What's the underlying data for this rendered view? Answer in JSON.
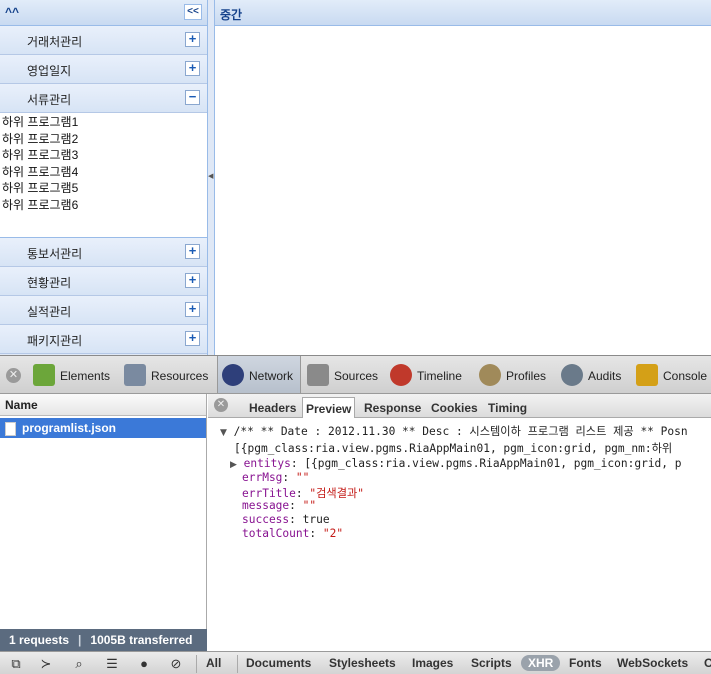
{
  "nav": {
    "header": "^^",
    "collapse_label": "<<",
    "items": [
      {
        "label": "거래처관리",
        "tool": "+"
      },
      {
        "label": "영업일지",
        "tool": "+"
      },
      {
        "label": "서류관리",
        "tool": "−"
      },
      {
        "label": "통보서관리",
        "tool": "+"
      },
      {
        "label": "현황관리",
        "tool": "+"
      },
      {
        "label": "실적관리",
        "tool": "+"
      },
      {
        "label": "패키지관리",
        "tool": "+"
      }
    ],
    "sub_items": [
      "하위 프로그램1",
      "하위 프로그램2",
      "하위 프로그램3",
      "하위 프로그램4",
      "하위 프로그램5",
      "하위 프로그램6"
    ]
  },
  "center": {
    "title": "중간"
  },
  "devtools": {
    "tabs": [
      {
        "label": "Elements",
        "icon": "elements-icon",
        "color": "#6ca63a"
      },
      {
        "label": "Resources",
        "icon": "resources-icon",
        "color": "#7a8aa0"
      },
      {
        "label": "Network",
        "icon": "network-icon",
        "color": "#2e3f7a"
      },
      {
        "label": "Sources",
        "icon": "sources-icon",
        "color": "#8a8a8a"
      },
      {
        "label": "Timeline",
        "icon": "timeline-icon",
        "color": "#c0392b"
      },
      {
        "label": "Profiles",
        "icon": "profiles-icon",
        "color": "#a08a5a"
      },
      {
        "label": "Audits",
        "icon": "audits-icon",
        "color": "#6a7a8a"
      },
      {
        "label": "Console",
        "icon": "console-icon",
        "color": "#d4a017"
      }
    ],
    "active_tab": "Network",
    "name_header": "Name",
    "request": "programlist.json",
    "status": {
      "requests": "1 requests",
      "transferred": "1005B transferred"
    },
    "sub_tabs": [
      "Headers",
      "Preview",
      "Response",
      "Cookies",
      "Timing"
    ],
    "active_sub_tab": "Preview",
    "preview": {
      "line1": "/** ** Date : 2012.11.30 ** Desc : 시스템이하 프로그램 리스트 제공 ** Posn",
      "line2": "[{pgm_class:ria.view.pgms.RiaAppMain01, pgm_icon:grid, pgm_nm:하위 ",
      "entitys_key": "entitys",
      "entitys_val": "[{pgm_class:ria.view.pgms.RiaAppMain01, pgm_icon:grid, p",
      "errMsg_key": "errMsg",
      "errMsg_val": "\"\"",
      "errTitle_key": "errTitle",
      "errTitle_val": "\"검색결과\"",
      "message_key": "message",
      "message_val": "\"\"",
      "success_key": "success",
      "success_val": "true",
      "totalCount_key": "totalCount",
      "totalCount_val": "\"2\""
    },
    "filters": [
      "All",
      "Documents",
      "Stylesheets",
      "Images",
      "Scripts",
      "XHR",
      "Fonts",
      "WebSockets",
      "O"
    ],
    "active_filter": "XHR"
  }
}
